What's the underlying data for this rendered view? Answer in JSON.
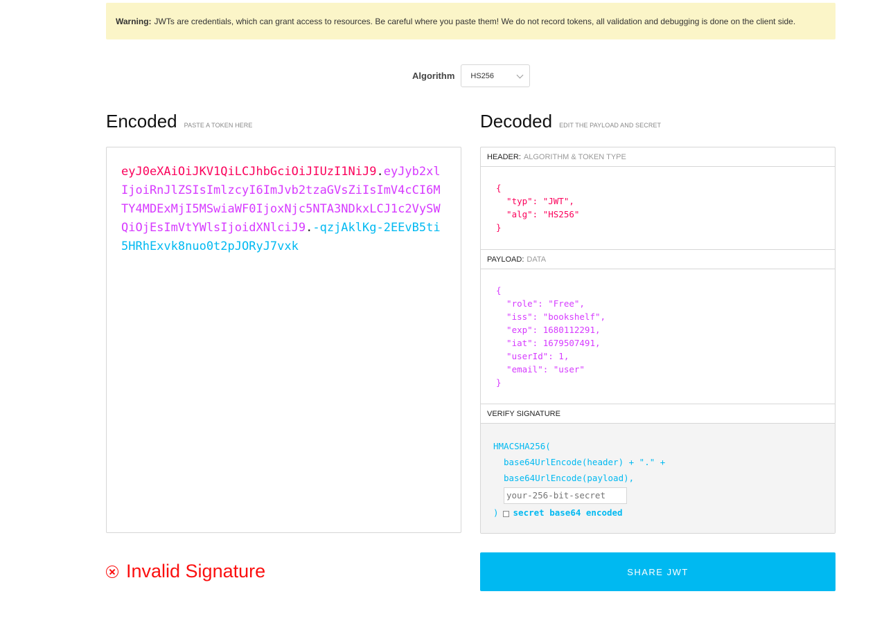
{
  "warning": {
    "label": "Warning:",
    "text": "JWTs are credentials, which can grant access to resources. Be careful where you paste them! We do not record tokens, all validation and debugging is done on the client side."
  },
  "algorithm": {
    "label": "Algorithm",
    "selected": "HS256"
  },
  "encoded": {
    "title": "Encoded",
    "subtitle": "PASTE A TOKEN HERE",
    "token_header": "eyJ0eXAiOiJKV1QiLCJhbGciOiJIUzI1NiJ9",
    "dot1": ".",
    "token_payload": "eyJyb2xlIjoiRnJlZSIsImlzcyI6ImJvb2tzaGVsZiIsImV4cCI6MTY4MDExMjI5MSwiaWF0IjoxNjc5NTA3NDkxLCJ1c2VySWQiOjEsImVtYWlsIjoidXNlciJ9",
    "dot2": ".",
    "token_signature": "-qzjAklKg-2EEvB5ti5HRhExvk8nuo0t2pJORyJ7vxk"
  },
  "decoded": {
    "title": "Decoded",
    "subtitle": "EDIT THE PAYLOAD AND SECRET",
    "header": {
      "label": "HEADER:",
      "sublabel": "ALGORITHM & TOKEN TYPE",
      "json": "{\n  \"typ\": \"JWT\",\n  \"alg\": \"HS256\"\n}"
    },
    "payload": {
      "label": "PAYLOAD:",
      "sublabel": "DATA",
      "json": "{\n  \"role\": \"Free\",\n  \"iss\": \"bookshelf\",\n  \"exp\": 1680112291,\n  \"iat\": 1679507491,\n  \"userId\": 1,\n  \"email\": \"user\"\n}"
    },
    "verify": {
      "label": "VERIFY SIGNATURE",
      "line1": "HMACSHA256(",
      "line2": "base64UrlEncode(header) + \".\" +",
      "line3": "base64UrlEncode(payload),",
      "secret_placeholder": "your-256-bit-secret",
      "close": ")",
      "checkbox_label": "secret base64 encoded"
    }
  },
  "status": {
    "text": "Invalid Signature",
    "color": "#fb0f0f"
  },
  "share_button": "SHARE JWT",
  "colors": {
    "header": "#fb015b",
    "payload": "#d63aff",
    "signature": "#00b9f1",
    "warning_bg": "#fbf5c8"
  }
}
